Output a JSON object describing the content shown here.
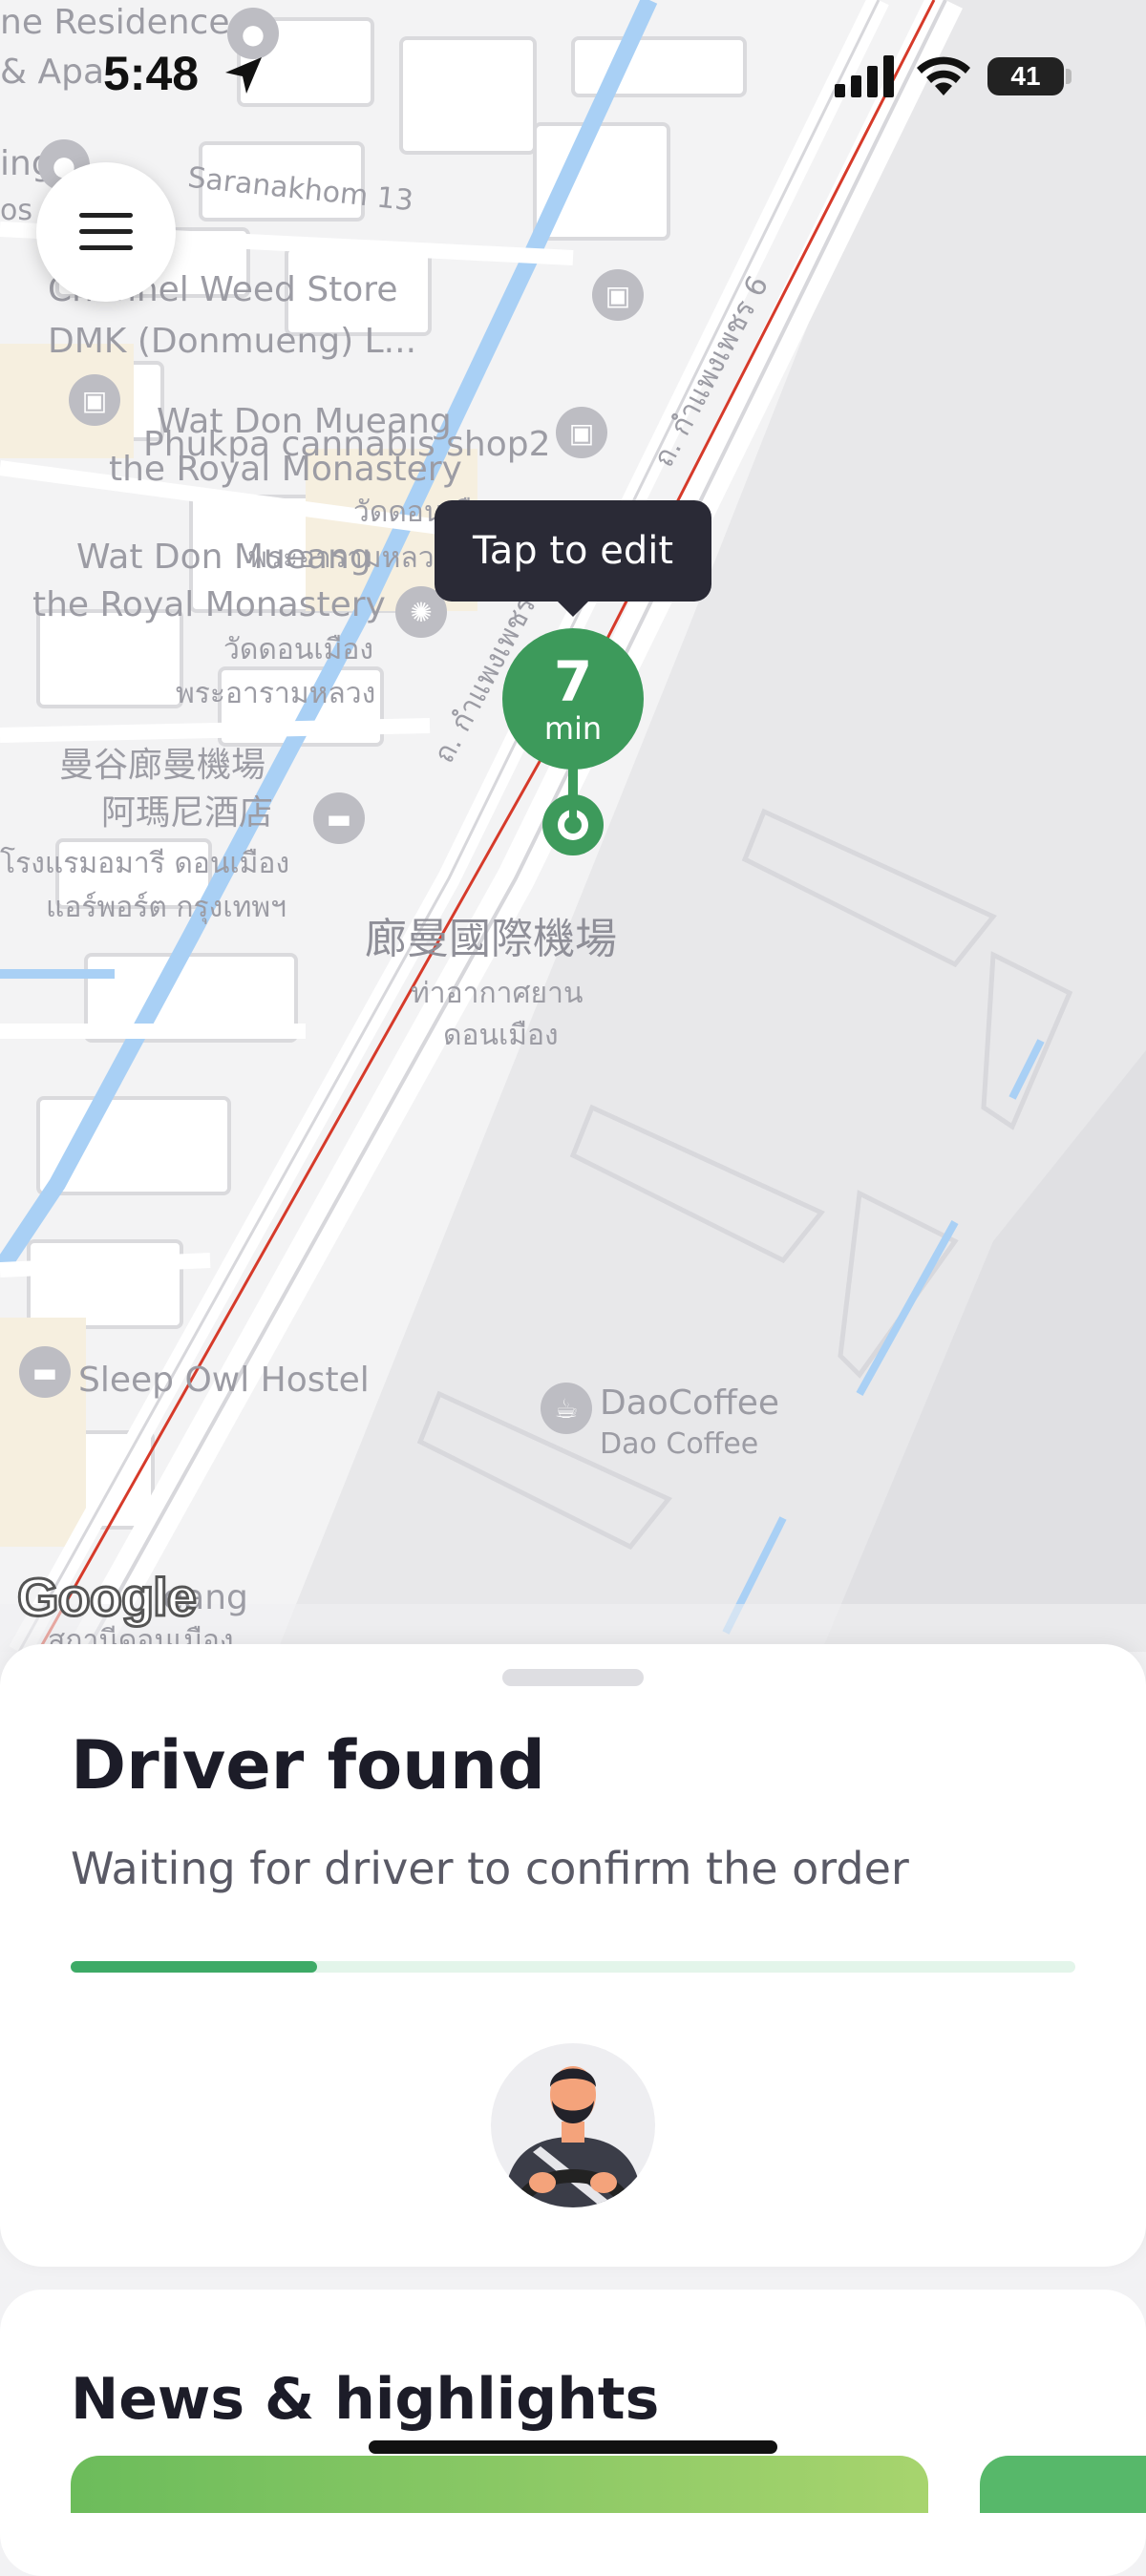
{
  "status_bar": {
    "time": "5:48",
    "battery": "41",
    "icons": [
      "location-arrow-icon",
      "signal-icon",
      "wifi-icon",
      "battery-icon"
    ]
  },
  "map": {
    "labels": {
      "residence": "ne Residence",
      "apa": "& Apa",
      "ing": "ing",
      "os": "os",
      "saranakhom": "Saranakhom 13",
      "weed_store_1": "Channel Weed Store",
      "weed_store_2": "DMK (Donmueng) L...",
      "wat_don_mueang_1": "Wat Don Mueang",
      "wat_don_mueang_2": "the Royal Monastery",
      "phukpa": "Phukpa cannabis shop2",
      "wat_thai_1": "วัดดอนเมือง",
      "wat_don_mueang_3": "Wat Don Mueang",
      "wat_thai_2": "พระอารามหลวง",
      "wat_don_mueang_4": "the Royal Monastery",
      "wat_thai_3": "วัดดอนเมือง",
      "wat_thai_4": "พระอารามหลวง",
      "hotel_cn_1": "曼谷廊曼機場",
      "hotel_cn_2": "阿瑪尼酒店",
      "hotel_th_1": "โรงแรมอมารี ดอนเมือง",
      "hotel_th_2": "แอร์พอร์ต กรุงเทพฯ",
      "airport_cn": "廊曼國際機場",
      "airport_th_1": "ท่าอากาศยาน",
      "airport_th_2": "ดอนเมือง",
      "road_1": "ถ. กำแพงเพชร 6",
      "road_2": "ถ. กำแพงเพชร",
      "sleep_owl": "Sleep Owl Hostel",
      "dao_coffee_1": "DaoCoffee",
      "dao_coffee_2": "Dao Coffee",
      "eang": "eang",
      "bottom_th": "สถานีดอนเมือง"
    },
    "attribution": "Google"
  },
  "menu_button": {
    "icon": "hamburger-menu-icon"
  },
  "pickup_pin": {
    "tooltip": "Tap to edit",
    "eta_value": "7",
    "eta_unit": "min",
    "color": "#3d9a5b"
  },
  "sheet": {
    "title": "Driver found",
    "subtitle": "Waiting for driver to confirm the order",
    "progress": 0.245,
    "progress_color": "#3daa66",
    "avatar_icon": "driver-avatar-icon"
  },
  "news": {
    "title": "News & highlights"
  }
}
